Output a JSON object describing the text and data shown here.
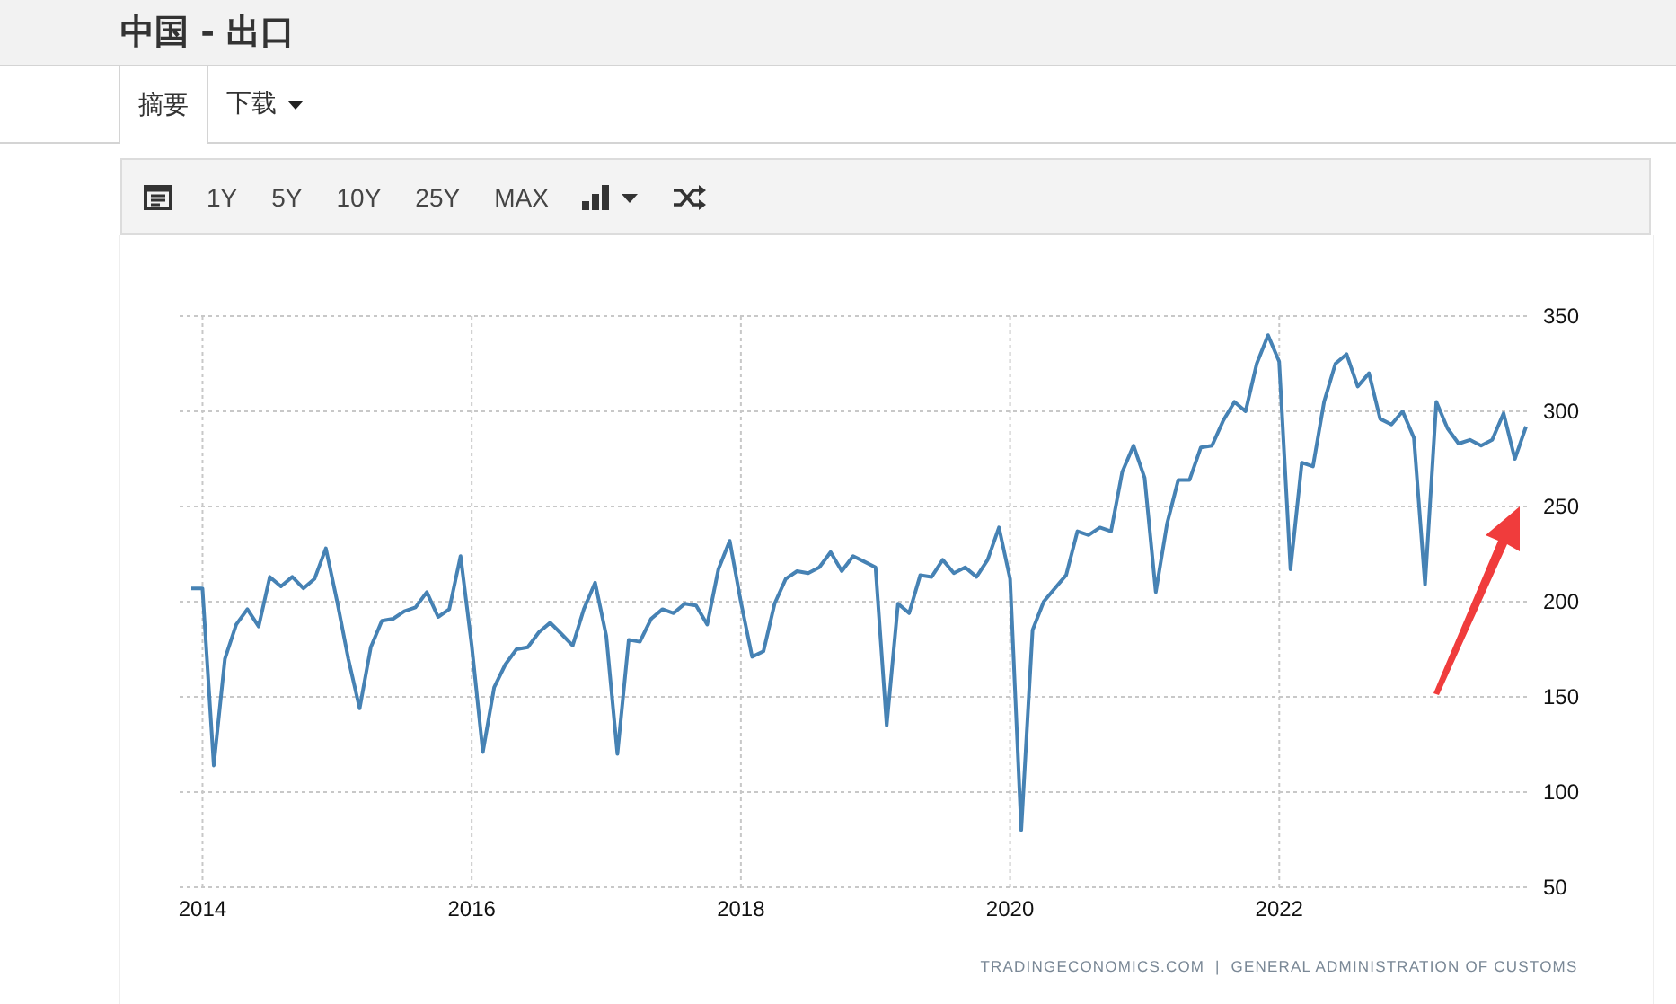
{
  "title": "中国 - 出口",
  "tabs": [
    {
      "label": "摘要",
      "selected": true,
      "kind": "plain"
    },
    {
      "label": "下载",
      "selected": false,
      "kind": "dropdown"
    }
  ],
  "toolbar": {
    "ranges": [
      "1Y",
      "5Y",
      "10Y",
      "25Y",
      "MAX"
    ]
  },
  "chart": {
    "source": "TRADINGECONOMICS.COM  |  GENERAL ADMINISTRATION OF CUSTOMS",
    "chart_data": {
      "type": "line",
      "xlim": [
        2013.83,
        2023.84
      ],
      "grid": true,
      "ylim": [
        50,
        350
      ],
      "yticks": [
        50,
        100,
        150,
        200,
        250,
        300,
        350
      ],
      "xticks": [
        {
          "value": 2014,
          "label": "2014"
        },
        {
          "value": 2016,
          "label": "2016"
        },
        {
          "value": 2018,
          "label": "2018"
        },
        {
          "value": 2020,
          "label": "2020"
        },
        {
          "value": 2022,
          "label": "2022"
        }
      ],
      "x": [
        2013.917,
        2014,
        2014.083,
        2014.167,
        2014.25,
        2014.333,
        2014.417,
        2014.5,
        2014.583,
        2014.667,
        2014.75,
        2014.833,
        2014.917,
        2015,
        2015.083,
        2015.167,
        2015.25,
        2015.333,
        2015.417,
        2015.5,
        2015.583,
        2015.667,
        2015.75,
        2015.833,
        2015.917,
        2016,
        2016.083,
        2016.167,
        2016.25,
        2016.333,
        2016.417,
        2016.5,
        2016.583,
        2016.667,
        2016.75,
        2016.833,
        2016.917,
        2017,
        2017.083,
        2017.167,
        2017.25,
        2017.333,
        2017.417,
        2017.5,
        2017.583,
        2017.667,
        2017.75,
        2017.833,
        2017.917,
        2018,
        2018.083,
        2018.167,
        2018.25,
        2018.333,
        2018.417,
        2018.5,
        2018.583,
        2018.667,
        2018.75,
        2018.833,
        2018.917,
        2019,
        2019.083,
        2019.167,
        2019.25,
        2019.333,
        2019.417,
        2019.5,
        2019.583,
        2019.667,
        2019.75,
        2019.833,
        2019.917,
        2020,
        2020.083,
        2020.167,
        2020.25,
        2020.333,
        2020.417,
        2020.5,
        2020.583,
        2020.667,
        2020.75,
        2020.833,
        2020.917,
        2021,
        2021.083,
        2021.167,
        2021.25,
        2021.333,
        2021.417,
        2021.5,
        2021.583,
        2021.667,
        2021.75,
        2021.833,
        2021.917,
        2022,
        2022.083,
        2022.167,
        2022.25,
        2022.333,
        2022.417,
        2022.5,
        2022.583,
        2022.667,
        2022.75,
        2022.833,
        2022.917,
        2023,
        2023.083,
        2023.167,
        2023.25,
        2023.333,
        2023.417,
        2023.5,
        2023.583,
        2023.667,
        2023.75,
        2023.833
      ],
      "series": [
        {
          "color": "#4682b4",
          "values": [
            207,
            207,
            114,
            170,
            188,
            196,
            187,
            213,
            208,
            213,
            207,
            212,
            228,
            200,
            170,
            144,
            176,
            190,
            191,
            195,
            197,
            205,
            192,
            196,
            224,
            177,
            121,
            155,
            167,
            175,
            176,
            184,
            189,
            183,
            177,
            196,
            210,
            182,
            120,
            180,
            179,
            191,
            196,
            194,
            199,
            198,
            188,
            217,
            232,
            200,
            171,
            174,
            199,
            212,
            216,
            215,
            218,
            226,
            216,
            224,
            221,
            218,
            135,
            199,
            194,
            214,
            213,
            222,
            215,
            218,
            213,
            222,
            239,
            212,
            80,
            185,
            200,
            207,
            214,
            237,
            235,
            239,
            237,
            268,
            282,
            265,
            205,
            241,
            264,
            264,
            281,
            282,
            295,
            305,
            300,
            325,
            340,
            326,
            217,
            273,
            271,
            305,
            325,
            330,
            313,
            320,
            296,
            293,
            300,
            286,
            209,
            305,
            291,
            283,
            285,
            282,
            285,
            299,
            275,
            292
          ]
        }
      ]
    }
  }
}
